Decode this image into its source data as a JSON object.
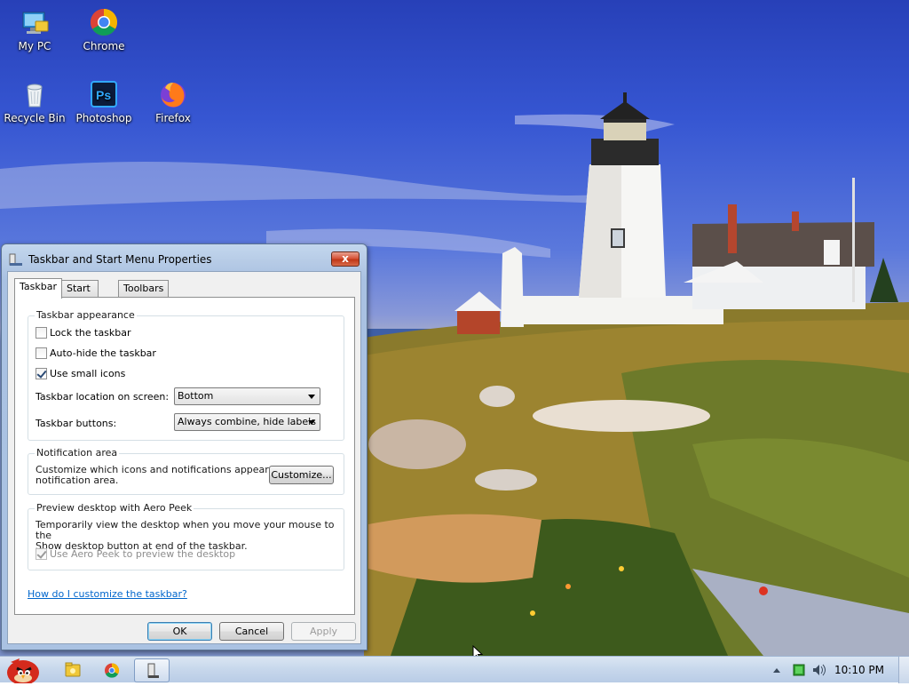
{
  "desktop": {
    "icons": [
      {
        "label": "My PC"
      },
      {
        "label": "Chrome"
      },
      {
        "label": "Recycle Bin"
      },
      {
        "label": "Photoshop"
      },
      {
        "label": "Firefox"
      }
    ]
  },
  "dialog": {
    "title": "Taskbar and Start Menu Properties",
    "close_glyph": "x",
    "tabs": [
      {
        "label": "Taskbar",
        "active": true
      },
      {
        "label": "Start Menu",
        "active": false
      },
      {
        "label": "Toolbars",
        "active": false
      }
    ],
    "appearance": {
      "title": "Taskbar appearance",
      "lock": {
        "label": "Lock the taskbar",
        "checked": false
      },
      "autohide": {
        "label": "Auto-hide the taskbar",
        "checked": false
      },
      "small_icons": {
        "label": "Use small icons",
        "checked": true
      },
      "location_label": "Taskbar location on screen:",
      "location_value": "Bottom",
      "buttons_label": "Taskbar buttons:",
      "buttons_value": "Always combine, hide labels"
    },
    "notification": {
      "title": "Notification area",
      "text_line1": "Customize which icons and notifications appear in the",
      "text_line2": "notification area.",
      "customize_label": "Customize..."
    },
    "aero_peek": {
      "title": "Preview desktop with Aero Peek",
      "text_line1": "Temporarily view the desktop when you move your mouse to the",
      "text_line2": "Show desktop button at end of the taskbar.",
      "checkbox": {
        "label": "Use Aero Peek to preview the desktop",
        "checked": true,
        "enabled": false
      }
    },
    "help_link": "How do I customize the taskbar?",
    "buttons": {
      "ok": "OK",
      "cancel": "Cancel",
      "apply": "Apply"
    }
  },
  "taskbar": {
    "clock": "10:10 PM",
    "items": [
      "start-button",
      "explorer",
      "chrome",
      "taskbar-properties"
    ],
    "colors": {
      "start_red": "#d42a1c",
      "folder": "#f0c838",
      "chrome_red": "#db4437"
    }
  }
}
